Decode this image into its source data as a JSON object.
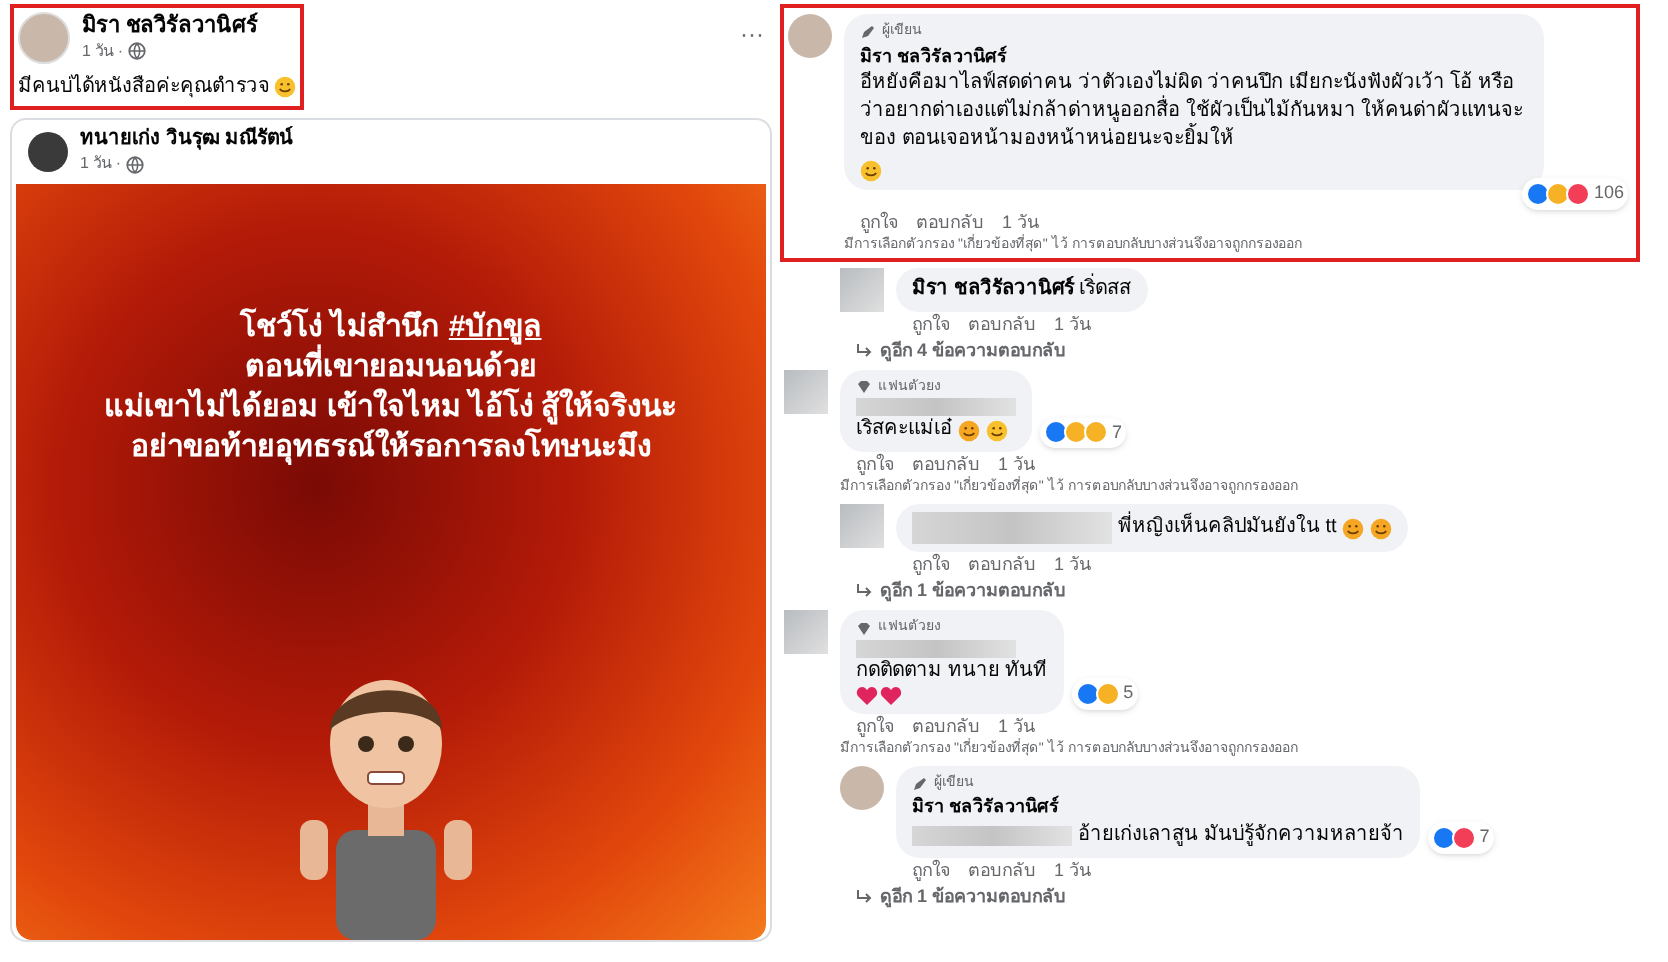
{
  "post": {
    "author": "มิรา ชลวิรัลวานิศร์",
    "time": "1 วัน ·",
    "text": "มีคนบ่ได้หนังสือค่ะคุณตำรวจ",
    "highlighted": true,
    "menu": "···",
    "shared": {
      "author": "ทนายเก่ง วินรุฒ มณีรัตน์",
      "time": "1 วัน ·",
      "poster": {
        "title": "โชว์โง่ ไม่สำนึก",
        "hashtag": "#บักขูล",
        "lines": [
          "ตอนที่เขายอมนอนด้วย",
          "แม่เขาไม่ได้ยอม เข้าใจไหม ไอ้โง่ สู้ให้จริงนะ",
          "อย่าขอท้ายอุทธรณ์ให้รอการลงโทษนะมึง"
        ]
      }
    }
  },
  "comments": [
    {
      "kind": "comment",
      "highlighted": true,
      "badge": {
        "kind": "author",
        "label": "ผู้เขียน"
      },
      "author": "มิรา ชลวิรัลวานิศร์",
      "blurred_prefix": false,
      "text": "อีหยังคือมาไลฟ์สดด่าคน ว่าตัวเองไม่ผิด ว่าคนปึก เมียกะนังฟังผัวเว้า โอ้ หรือว่าอยากด่าเองแต่ไม่กล้าด่าหนูออกสื่อ ใช้ผัวเป็นไม้กันหมา ให้คนด่าผัวแทนจะของ ตอนเจอหน้ามองหน้าหน่อยนะจะยิ้มให้",
      "emojis": [
        {
          "kind": "wink"
        }
      ],
      "reactions": [
        {
          "kind": "like"
        },
        {
          "kind": "haha"
        },
        {
          "kind": "love"
        }
      ],
      "count": "106",
      "actions": [
        "ถูกใจ",
        "ตอบกลับ",
        "1 วัน"
      ],
      "note": "มีการเลือกตัวกรอง \"เกี่ยวข้องที่สุด\" ไว้ การตอบกลับบางส่วนจึงอาจถูกกรองออก"
    },
    {
      "kind": "reply",
      "highlighted": false,
      "author": "มิรา ชลวิรัลวานิศร์",
      "blurred_prefix": false,
      "text": "เริ่ดสส",
      "actions": [
        "ถูกใจ",
        "ตอบกลับ",
        "1 วัน"
      ],
      "more": "ดูอีก 4 ข้อความตอบกลับ"
    },
    {
      "kind": "comment",
      "highlighted": false,
      "badge": {
        "kind": "fan",
        "label": "แฟนตัวยง"
      },
      "blurred_prefix": false,
      "text": "เริสคะแม่เอ๋",
      "emojis": [
        {
          "kind": "laugh"
        },
        {
          "kind": "smile"
        }
      ],
      "reactions": [
        {
          "kind": "like"
        },
        {
          "kind": "haha"
        },
        {
          "kind": "sad"
        }
      ],
      "count": "7",
      "actions": [
        "ถูกใจ",
        "ตอบกลับ",
        "1 วัน"
      ],
      "note": "มีการเลือกตัวกรอง \"เกี่ยวข้องที่สุด\" ไว้ การตอบกลับบางส่วนจึงอาจถูกกรองออก"
    },
    {
      "kind": "reply",
      "highlighted": false,
      "blurred_prefix": true,
      "text": "พี่หญิงเห็นคลิปมันยังใน tt",
      "emojis": [
        {
          "kind": "laugh"
        },
        {
          "kind": "laugh"
        }
      ],
      "actions": [
        "ถูกใจ",
        "ตอบกลับ",
        "1 วัน"
      ],
      "more": "ดูอีก 1 ข้อความตอบกลับ"
    },
    {
      "kind": "comment",
      "highlighted": false,
      "badge": {
        "kind": "fan",
        "label": "แฟนตัวยง"
      },
      "blurred_prefix": false,
      "text": "กดติดตาม ทนาย ทันที",
      "emoji_line": [
        {
          "kind": "heart"
        },
        {
          "kind": "heart"
        }
      ],
      "reactions": [
        {
          "kind": "like"
        },
        {
          "kind": "wow"
        }
      ],
      "count": "5",
      "actions": [
        "ถูกใจ",
        "ตอบกลับ",
        "1 วัน"
      ],
      "note": "มีการเลือกตัวกรอง \"เกี่ยวข้องที่สุด\" ไว้ การตอบกลับบางส่วนจึงอาจถูกกรองออก"
    },
    {
      "kind": "reply",
      "highlighted": false,
      "badge": {
        "kind": "author",
        "label": "ผู้เขียน"
      },
      "author": "มิรา ชลวิรัลวานิศร์",
      "blurred_prefix": true,
      "text": "อ้ายเก่งเลาสูน มันบ่รู้จักความหลายจ้า",
      "reactions": [
        {
          "kind": "like"
        },
        {
          "kind": "love"
        }
      ],
      "count": "7",
      "actions": [
        "ถูกใจ",
        "ตอบกลับ",
        "1 วัน"
      ],
      "more": "ดูอีก 1 ข้อความตอบกลับ"
    }
  ]
}
